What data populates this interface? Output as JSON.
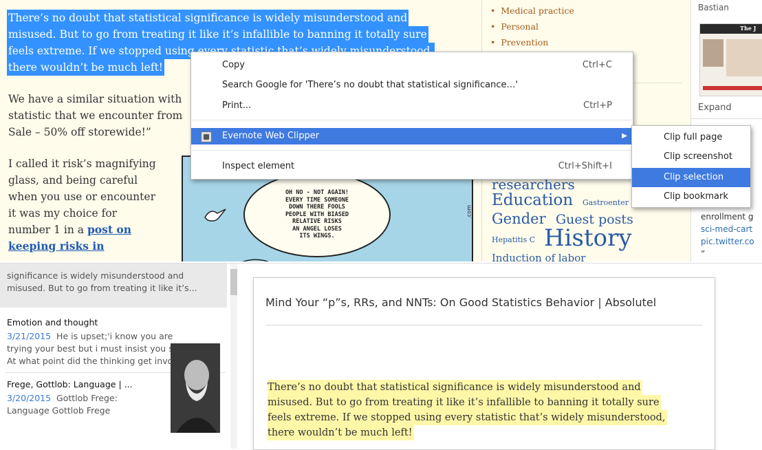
{
  "article": {
    "highlighted_lines": [
      "There’s no doubt that statistical significance is widely misunderstood and",
      "misused. But to go from treating it like it’s infallible to banning it totally sure",
      "feels extreme. If we stopped using every statistic that’s widely misunderstood,",
      "there wouldn’t be much left!"
    ],
    "para2_lines": [
      "We have a similar situation with",
      "statistic that we encounter from",
      "Sale – 50% off storewide!”"
    ],
    "para3_lines": [
      "I called it risk’s magnifying",
      "glass, and being careful",
      "when you use or encounter",
      "it was my choice for",
      "number 1 in a"
    ],
    "link_lines": [
      "post on",
      "keeping risks in"
    ]
  },
  "comic": {
    "bubble_text": "OH NO - NOT AGAIN!\nEVERY TIME SOMEONE\nDOWN THERE FOOLS\nPEOPLE WITH BIASED\nRELATIVE RISKS\nAN ANGEL LOSES\nITS WINGS.",
    "side_text": ".com"
  },
  "sidebar": {
    "categories": [
      "Medical practice",
      "Personal",
      "Prevention"
    ],
    "tags": {
      "researchers": "researchers",
      "education": "Education",
      "gastro": "Gastroenter",
      "gender": "Gender",
      "guest": "Guest posts",
      "hepatitis": "Hepatitis C",
      "history": "History",
      "induction": "Induction of labor"
    }
  },
  "far_column": {
    "name": "Bastian",
    "expand": "Expand",
    "thumb_title": "The J",
    "tweets": [
      "enrollment g",
      "sci-med-cart",
      "pic.twitter.co",
      "”"
    ]
  },
  "context_menu": {
    "items": [
      {
        "label": "Copy",
        "shortcut": "Ctrl+C"
      },
      {
        "label": "Search Google for 'There’s no doubt that statistical significance…'",
        "shortcut": ""
      },
      {
        "label": "Print...",
        "shortcut": "Ctrl+P"
      },
      {
        "label": "Evernote Web Clipper",
        "shortcut": ""
      },
      {
        "label": "Inspect element",
        "shortcut": "Ctrl+Shift+I"
      }
    ],
    "submenu": [
      "Clip full page",
      "Clip screenshot",
      "Clip selection",
      "Clip bookmark"
    ],
    "active_item": "Evernote Web Clipper",
    "active_subitem": "Clip selection"
  },
  "note_list": {
    "first_preview": [
      "significance is widely misunderstood and",
      "misused. But to go from treating it like it’s..."
    ],
    "notes": [
      {
        "title": "Emotion and thought",
        "date": "3/21/2015",
        "lines": [
          "He is upset;'i know you are",
          "trying your best but i must insist you stop!'",
          "At what point did the thinking get involve..."
        ]
      },
      {
        "title": "Frege, Gottlob: Language | ...",
        "date": "3/20/2015",
        "lines": [
          "Gottlob Frege:",
          "Language Gottlob Frege"
        ]
      }
    ]
  },
  "editor": {
    "title": "Mind Your “p”s, RRs, and NNTs: On Good Statistics Behavior | Absolutel",
    "body_lines": [
      "There’s no doubt that statistical significance is widely misunderstood and",
      "misused. But to go from treating it like it’s infallible to banning it totally sure",
      "feels extreme. If we stopped using every statistic that’s widely misunderstood,",
      "there wouldn’t be much left!"
    ]
  },
  "colors": {
    "selection": "#3392ff",
    "menu_highlight": "#3e7ae0",
    "note_highlight": "#fff7a8",
    "link": "#1f5bb5"
  }
}
